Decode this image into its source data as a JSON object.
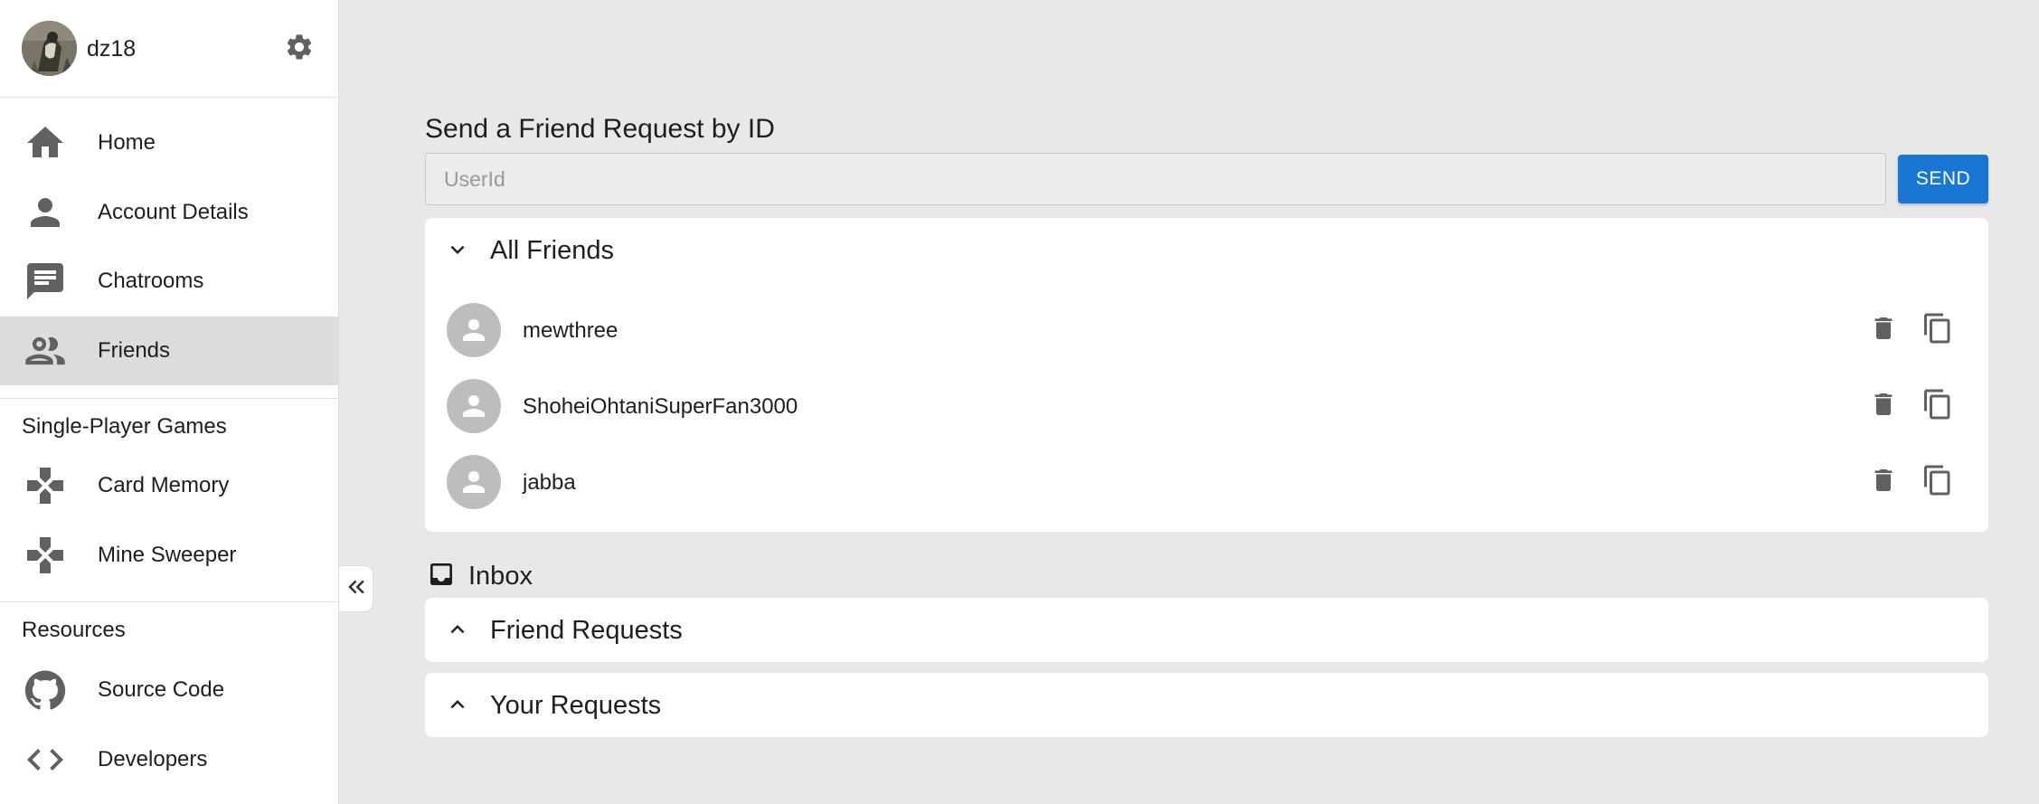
{
  "profile": {
    "username": "dz18",
    "avatar": "profile-photo",
    "settings_icon": "gear-icon"
  },
  "nav": {
    "main": [
      {
        "label": "Home",
        "icon": "home-icon"
      },
      {
        "label": "Account Details",
        "icon": "person-icon"
      },
      {
        "label": "Chatrooms",
        "icon": "chat-icon"
      },
      {
        "label": "Friends",
        "icon": "people-icon",
        "active": true
      }
    ],
    "games_header": "Single-Player Games",
    "games": [
      {
        "label": "Card Memory",
        "icon": "gamepad-icon"
      },
      {
        "label": "Mine Sweeper",
        "icon": "gamepad-icon"
      }
    ],
    "resources_header": "Resources",
    "resources": [
      {
        "label": "Source Code",
        "icon": "github-icon"
      },
      {
        "label": "Developers",
        "icon": "code-icon"
      }
    ],
    "collapse_icon": "double-chevron-left-icon"
  },
  "send_request": {
    "title": "Send a Friend Request by ID",
    "placeholder": "UserId",
    "value": "",
    "button_label": "SEND"
  },
  "all_friends": {
    "title": "All Friends",
    "expanded": true,
    "friends": [
      {
        "name": "mewthree"
      },
      {
        "name": "ShoheiOhtaniSuperFan3000"
      },
      {
        "name": "jabba"
      }
    ],
    "row_actions": [
      "delete-icon",
      "copy-icon"
    ]
  },
  "inbox": {
    "label": "Inbox",
    "icon": "inbox-icon",
    "sections": [
      {
        "title": "Friend Requests",
        "expanded": false
      },
      {
        "title": "Your Requests",
        "expanded": false
      }
    ]
  },
  "colors": {
    "accent": "#1976d2",
    "background": "#e8e8e8",
    "sidebar": "#ffffff",
    "active_nav": "#dcdcdc",
    "icon": "#616161"
  }
}
